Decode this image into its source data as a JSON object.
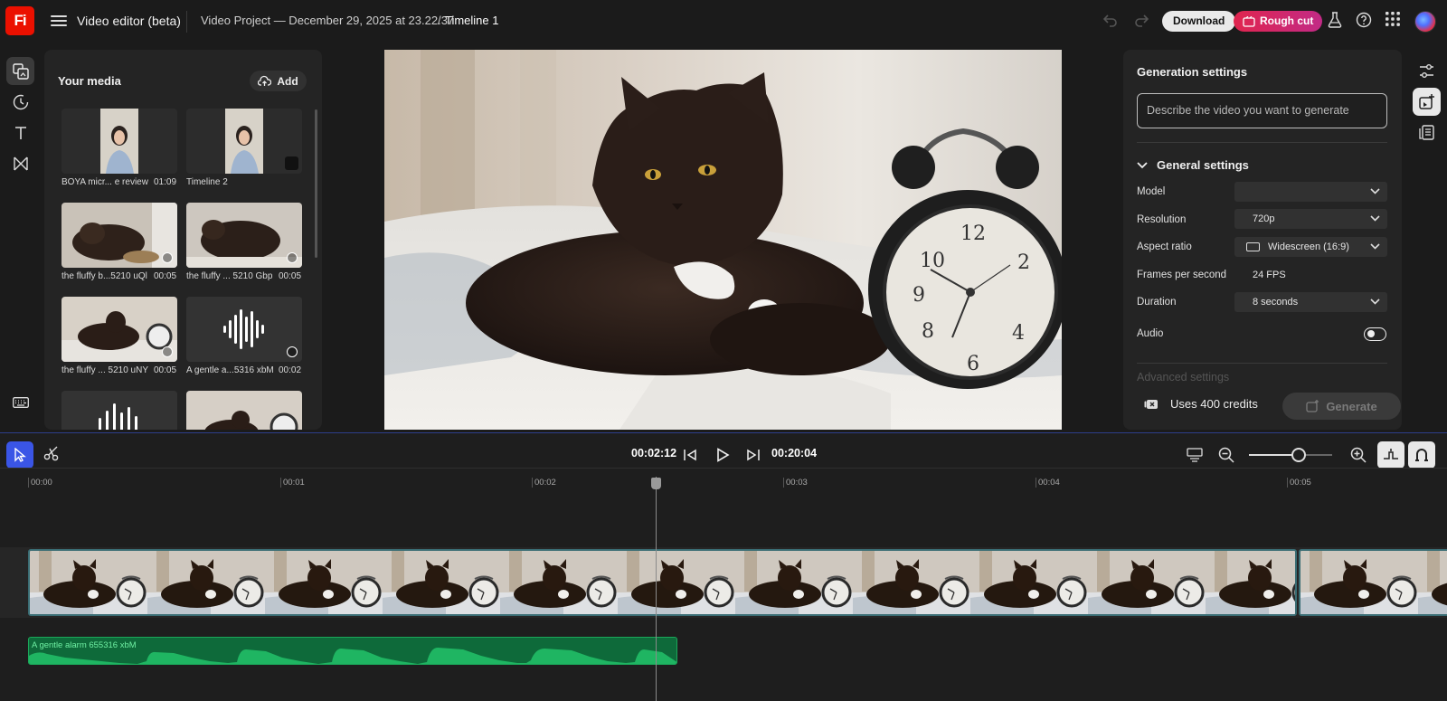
{
  "topbar": {
    "logo": "Fi",
    "app_title": "Video editor (beta)",
    "project_title": "Video Project — December 29, 2025 at 23.22.37",
    "separator": "/",
    "timeline_name": "Timeline 1",
    "download_label": "Download",
    "roughcut_label": "Rough cut"
  },
  "media": {
    "title": "Your media",
    "add_label": "Add",
    "items": [
      {
        "label": "BOYA micr... e review",
        "duration": "01:09"
      },
      {
        "label": "Timeline 2",
        "duration": ""
      },
      {
        "label": "the fluffy b...5210 uQl",
        "duration": "00:05"
      },
      {
        "label": "the fluffy ... 5210 Gbp",
        "duration": "00:05"
      },
      {
        "label": "the fluffy ... 5210 uNY",
        "duration": "00:05"
      },
      {
        "label": "A gentle a...5316 xbM",
        "duration": "00:02"
      }
    ]
  },
  "settings": {
    "title": "Generation settings",
    "prompt_placeholder": "Describe the video you want to generate",
    "general_title": "General settings",
    "rows": {
      "model_label": "Model",
      "model_value": "",
      "resolution_label": "Resolution",
      "resolution_value": "720p",
      "aspect_label": "Aspect ratio",
      "aspect_value": "Widescreen (16:9)",
      "fps_label": "Frames per second",
      "fps_value": "24 FPS",
      "duration_label": "Duration",
      "duration_value": "8 seconds",
      "audio_label": "Audio"
    },
    "advanced_title": "Advanced settings",
    "credits_label": "Uses 400 credits",
    "generate_label": "Generate"
  },
  "timeline": {
    "current_time": "00:02:12",
    "total_time": "00:20:04",
    "ticks": [
      "00:00",
      "00:01",
      "00:02",
      "00:03",
      "00:04",
      "00:05"
    ],
    "zoom_level": 0.6,
    "audio_clip_label": "A gentle alarm 655316 xbM"
  },
  "colors": {
    "accent": "#3a55e6",
    "roughcut_start": "#e0254e",
    "roughcut_end": "#c22a86",
    "audio_clip": "#0e6a3a"
  }
}
